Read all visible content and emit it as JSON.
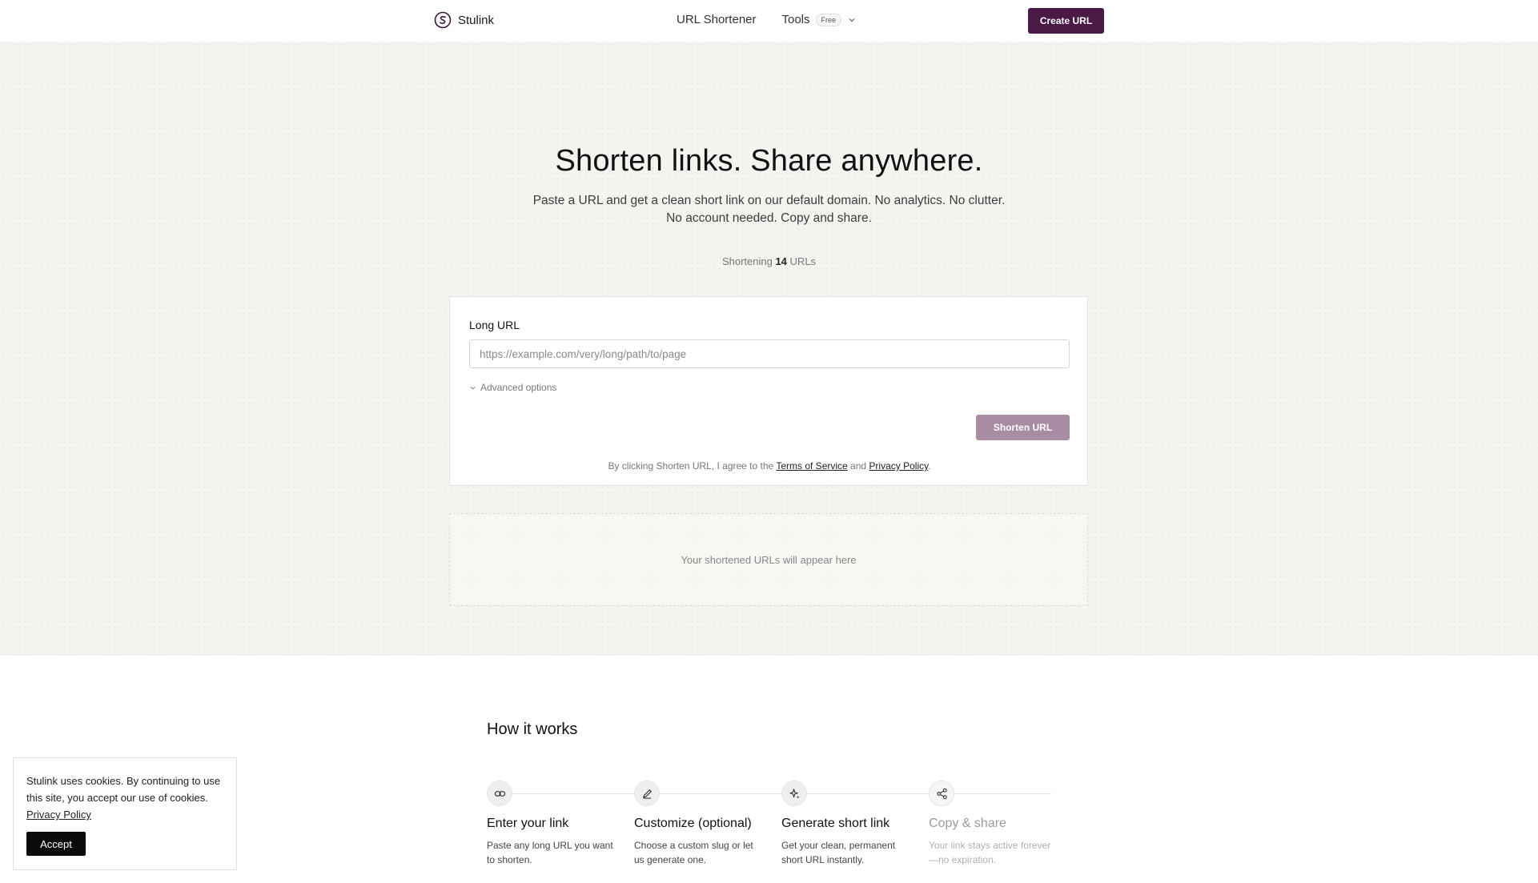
{
  "header": {
    "brand": "Stulink",
    "nav": {
      "url_shortener": "URL Shortener",
      "tools": "Tools",
      "tools_badge": "Free"
    },
    "create_button": "Create URL"
  },
  "hero": {
    "title": "Shorten links. Share anywhere.",
    "subtitle": "Paste a URL and get a clean short link on our default domain. No analytics. No clutter. No account needed. Copy and share.",
    "counter_prefix": "Shortening",
    "counter_value": "14",
    "counter_suffix": "URLs"
  },
  "form": {
    "label": "Long URL",
    "placeholder": "https://example.com/very/long/path/to/page",
    "value": "",
    "advanced_label": "Advanced options",
    "submit_label": "Shorten URL",
    "agree_prefix": "By clicking Shorten URL, I agree to the",
    "terms_link": "Terms of Service",
    "agree_and": "and",
    "privacy_link": "Privacy Policy",
    "agree_suffix": "."
  },
  "results": {
    "empty_text": "Your shortened URLs will appear here"
  },
  "how_it_works": {
    "title": "How it works",
    "steps": [
      {
        "icon": "link-icon",
        "title": "Enter your link",
        "desc": "Paste any long URL you want to shorten."
      },
      {
        "icon": "pencil-icon",
        "title": "Customize (optional)",
        "desc": "Choose a custom slug or let us generate one."
      },
      {
        "icon": "sparkle-icon",
        "title": "Generate short link",
        "desc": "Get your clean, permanent short URL instantly."
      },
      {
        "icon": "share-icon",
        "title": "Copy & share",
        "desc": "Your link stays active forever—no expiration."
      }
    ]
  },
  "cookie": {
    "text": "Stulink uses cookies. By continuing to use this site, you accept our use of cookies.",
    "policy_link": "Privacy Policy",
    "accept": "Accept"
  },
  "colors": {
    "brand": "#4a1a45",
    "submit_disabled": "#a88ca3",
    "hero_bg": "#f6f4f1"
  }
}
